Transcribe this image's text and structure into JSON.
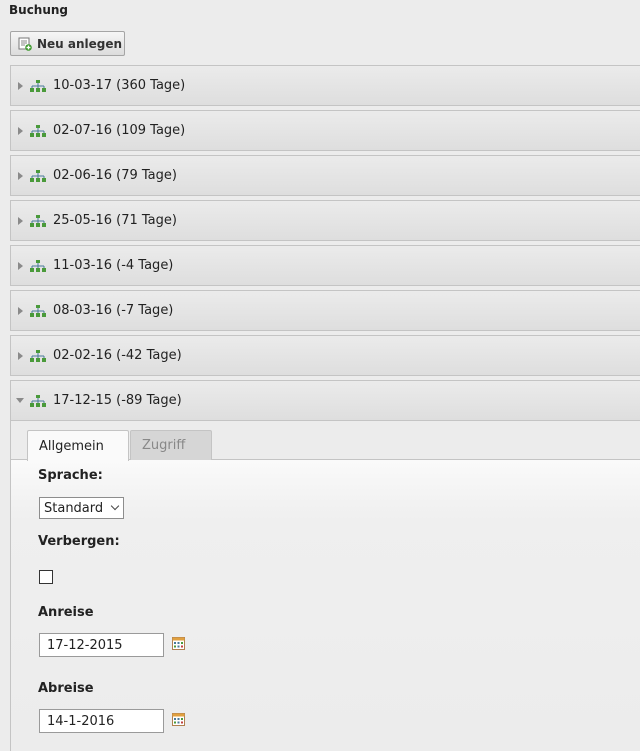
{
  "section": {
    "title": "Buchung"
  },
  "toolbar": {
    "new_label": "Neu anlegen",
    "new_icon": "new-record-icon"
  },
  "records": [
    {
      "label": "10-03-17 (360 Tage)",
      "expanded": false
    },
    {
      "label": "02-07-16 (109 Tage)",
      "expanded": false
    },
    {
      "label": "02-06-16 (79 Tage)",
      "expanded": false
    },
    {
      "label": "25-05-16 (71 Tage)",
      "expanded": false
    },
    {
      "label": "11-03-16 (-4 Tage)",
      "expanded": false
    },
    {
      "label": "08-03-16 (-7 Tage)",
      "expanded": false
    },
    {
      "label": "02-02-16 (-42 Tage)",
      "expanded": false
    },
    {
      "label": "17-12-15 (-89 Tage)",
      "expanded": true
    }
  ],
  "record_icon": "tree-structure-icon",
  "tabs": [
    {
      "label": "Allgemein",
      "active": true
    },
    {
      "label": "Zugriff",
      "active": false
    }
  ],
  "form": {
    "language_label": "Sprache:",
    "language_value": "Standard",
    "hide_label": "Verbergen:",
    "hide_checked": false,
    "arrival_label": "Anreise",
    "arrival_value": "17-12-2015",
    "departure_label": "Abreise",
    "departure_value": "14-1-2016",
    "calendar_icon": "calendar-icon"
  },
  "colors": {
    "tree_icon": "#4a9a3a",
    "calendar_accent": "#e0a040"
  }
}
